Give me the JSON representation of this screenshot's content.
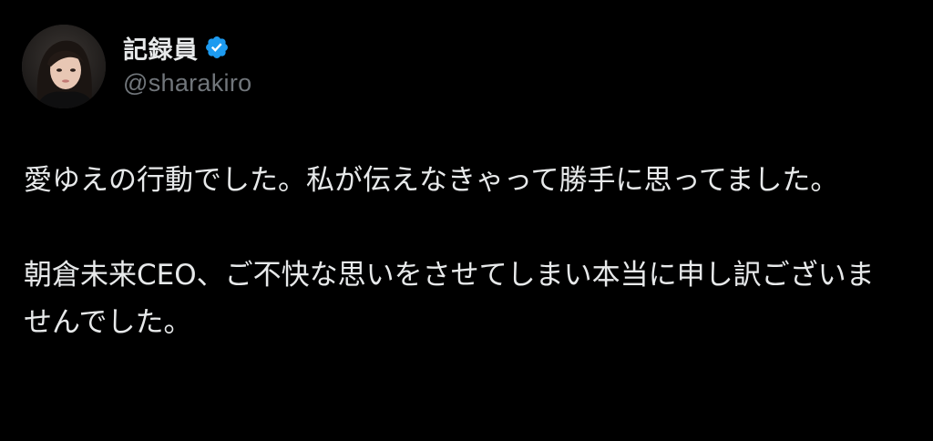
{
  "author": {
    "display_name": "記録員",
    "handle": "@sharakiro",
    "verified": true,
    "avatar_icon": "profile-photo",
    "verified_icon": "verified-badge-icon"
  },
  "tweet": {
    "paragraphs": [
      "愛ゆえの行動でした。私が伝えなきゃって勝手に思ってました。",
      "朝倉未来CEO、ご不快な思いをさせてしまい本当に申し訳ございませんでした。"
    ]
  },
  "colors": {
    "background": "#000000",
    "primary_text": "#e7e9ea",
    "secondary_text": "#71767b",
    "verified_blue": "#1d9bf0"
  }
}
